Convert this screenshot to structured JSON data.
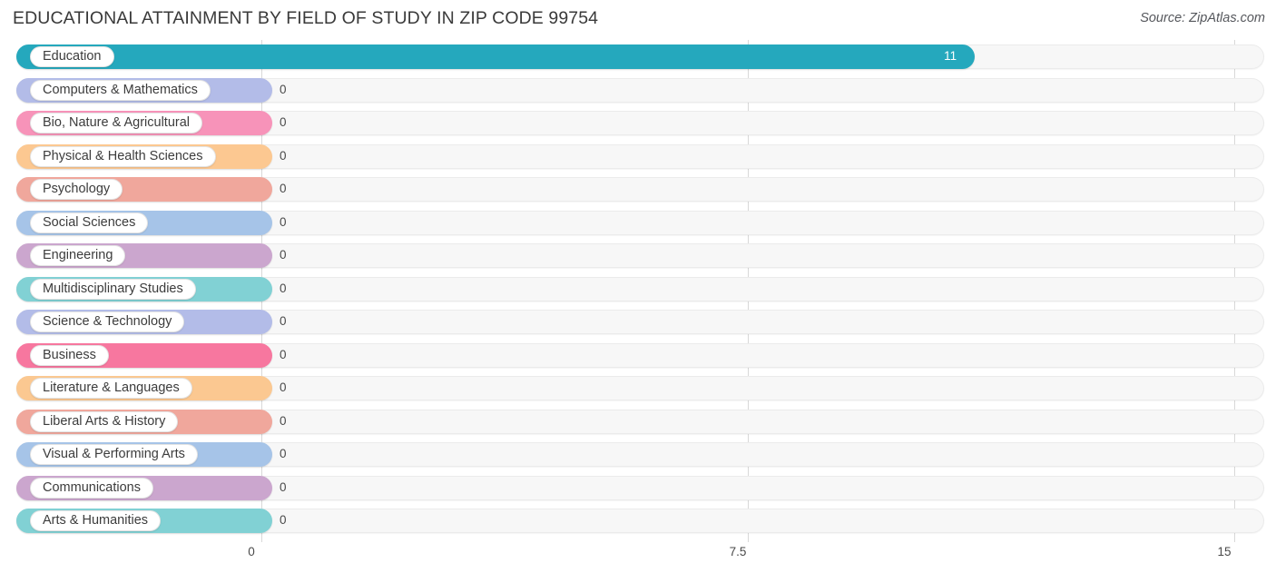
{
  "header": {
    "title": "EDUCATIONAL ATTAINMENT BY FIELD OF STUDY IN ZIP CODE 99754",
    "source": "Source: ZipAtlas.com"
  },
  "chart_data": {
    "type": "bar",
    "orientation": "horizontal",
    "title": "EDUCATIONAL ATTAINMENT BY FIELD OF STUDY IN ZIP CODE 99754",
    "xlabel": "",
    "ylabel": "",
    "xlim": [
      0,
      15
    ],
    "grid": true,
    "legend": "none",
    "tick_labels": [
      "0",
      "7.5",
      "15"
    ],
    "tick_values": [
      0,
      7.5,
      15
    ],
    "categories": [
      "Education",
      "Computers & Mathematics",
      "Bio, Nature & Agricultural",
      "Physical & Health Sciences",
      "Psychology",
      "Social Sciences",
      "Engineering",
      "Multidisciplinary Studies",
      "Science & Technology",
      "Business",
      "Literature & Languages",
      "Liberal Arts & History",
      "Visual & Performing Arts",
      "Communications",
      "Arts & Humanities"
    ],
    "values": [
      11,
      0,
      0,
      0,
      0,
      0,
      0,
      0,
      0,
      0,
      0,
      0,
      0,
      0,
      0
    ],
    "value_labels": [
      "11",
      "0",
      "0",
      "0",
      "0",
      "0",
      "0",
      "0",
      "0",
      "0",
      "0",
      "0",
      "0",
      "0",
      "0"
    ],
    "colors": [
      "#25a8bd",
      "#b3bce8",
      "#f793b9",
      "#fcc891",
      "#f0a79c",
      "#a6c4e8",
      "#cba6ce",
      "#81d1d4",
      "#b3bce8",
      "#f7779f",
      "#fbc891",
      "#f0a79c",
      "#a6c4e8",
      "#cba6ce",
      "#81d1d4"
    ]
  }
}
